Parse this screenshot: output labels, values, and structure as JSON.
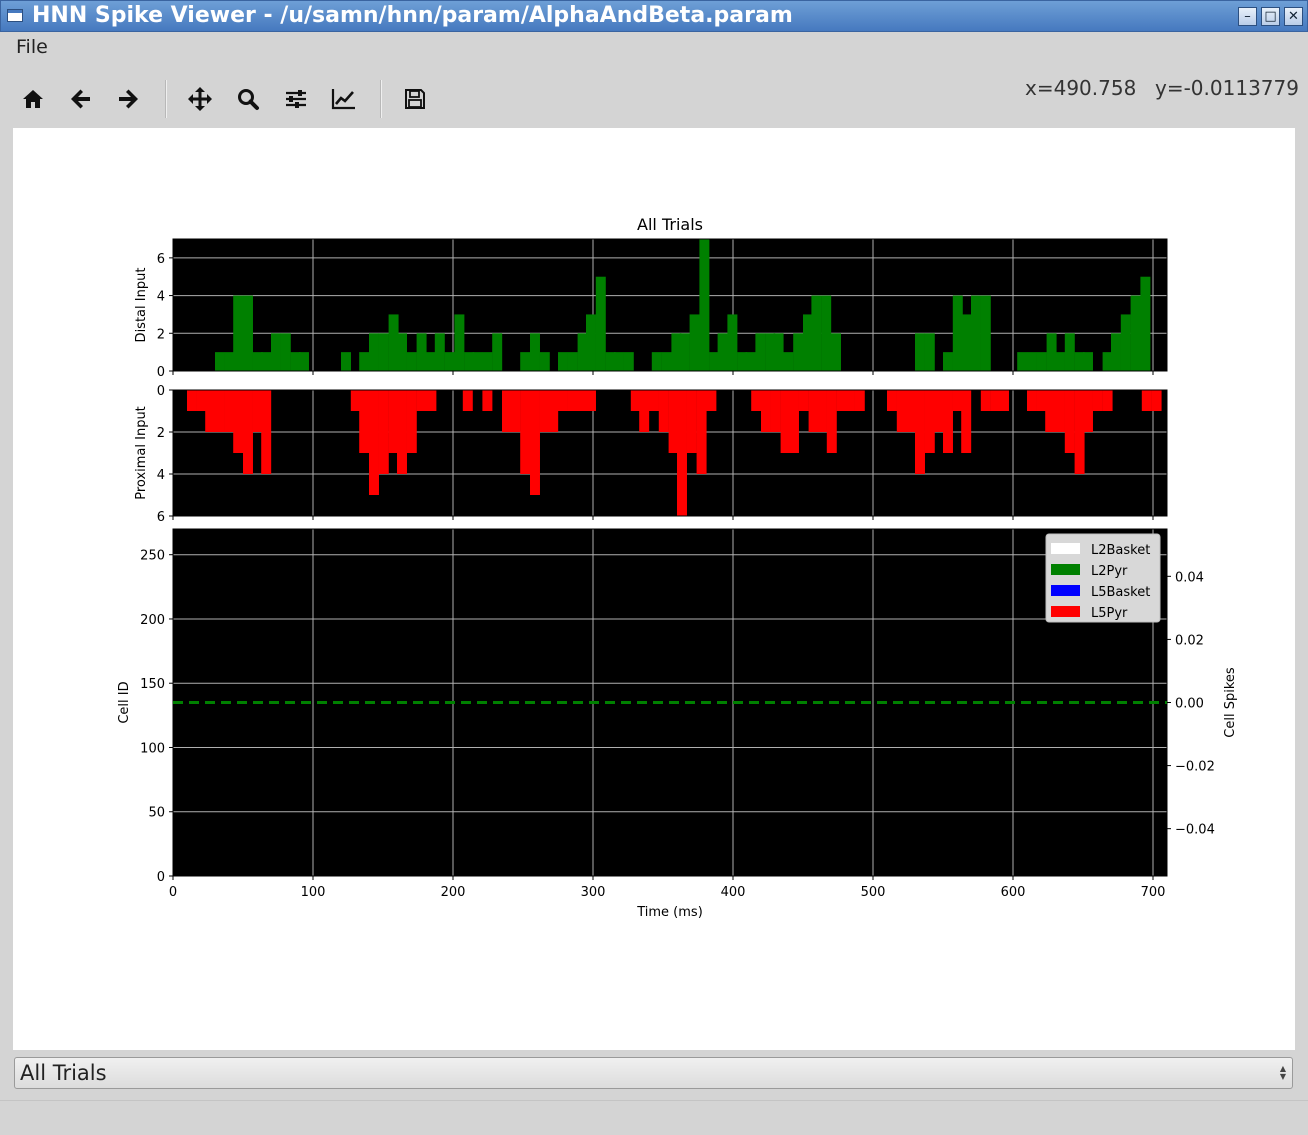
{
  "window": {
    "title": "HNN Spike Viewer - /u/samn/hnn/param/AlphaAndBeta.param"
  },
  "menu": {
    "file_label": "File"
  },
  "toolbar": {
    "buttons": [
      "home-icon",
      "back-arrow-icon",
      "forward-arrow-icon",
      "pan-icon",
      "zoom-icon",
      "subplots-icon",
      "axes-edit-icon",
      "save-icon"
    ],
    "coords": {
      "x": "x=490.758",
      "y": "y=-0.0113779"
    }
  },
  "colors": {
    "distal": "#008000",
    "proximal": "#ff0000",
    "plot_bg": "#000000",
    "grid": "#b0b0b0",
    "dashed_line": "#008000"
  },
  "chart_data": [
    {
      "type": "bar",
      "title": "All Trials",
      "ylabel": "Distal Input",
      "inverted_y": true,
      "xlim": [
        0,
        710
      ],
      "ylim": [
        7,
        0
      ],
      "yticks": [
        0,
        2,
        4,
        6
      ],
      "grid": true,
      "bin_width": 6.7,
      "series": [
        {
          "color": "#008000",
          "x": [
            30,
            37,
            43,
            50,
            57,
            63,
            70,
            77,
            84,
            90,
            120,
            127,
            133,
            140,
            147,
            154,
            160,
            167,
            174,
            181,
            187,
            194,
            201,
            208,
            214,
            221,
            228,
            248,
            255,
            262,
            275,
            282,
            289,
            295,
            302,
            309,
            315,
            322,
            342,
            349,
            356,
            362,
            369,
            376,
            383,
            389,
            396,
            403,
            409,
            416,
            423,
            429,
            436,
            443,
            450,
            456,
            463,
            470,
            530,
            537,
            543,
            550,
            557,
            563,
            570,
            577,
            584,
            603,
            610,
            617,
            624,
            630,
            637,
            644,
            650,
            664,
            670,
            677,
            684,
            691
          ],
          "y": [
            1,
            1,
            4,
            4,
            1,
            1,
            2,
            2,
            1,
            1,
            1,
            0,
            1,
            2,
            2,
            3,
            2,
            1,
            2,
            1,
            2,
            1,
            3,
            1,
            1,
            1,
            2,
            1,
            2,
            1,
            1,
            1,
            2,
            3,
            5,
            1,
            1,
            1,
            1,
            1,
            2,
            2,
            3,
            7,
            1,
            2,
            3,
            1,
            1,
            2,
            2,
            2,
            1,
            2,
            3,
            4,
            4,
            2,
            2,
            2,
            0,
            1,
            4,
            3,
            4,
            4,
            0,
            1,
            1,
            1,
            2,
            1,
            2,
            1,
            1,
            1,
            2,
            3,
            4,
            5
          ]
        }
      ]
    },
    {
      "type": "bar",
      "ylabel": "Proximal Input",
      "xlim": [
        0,
        710
      ],
      "ylim": [
        0,
        6
      ],
      "yticks": [
        0,
        2,
        4,
        6
      ],
      "grid": true,
      "bin_width": 6.7,
      "series": [
        {
          "color": "#ff0000",
          "x": [
            10,
            17,
            23,
            30,
            37,
            43,
            50,
            57,
            63,
            70,
            127,
            133,
            140,
            147,
            154,
            160,
            167,
            174,
            181,
            207,
            221,
            235,
            241,
            248,
            255,
            262,
            268,
            275,
            282,
            288,
            295,
            327,
            333,
            340,
            347,
            354,
            360,
            367,
            374,
            381,
            387,
            413,
            420,
            427,
            434,
            440,
            447,
            454,
            460,
            467,
            474,
            480,
            487,
            510,
            517,
            523,
            530,
            537,
            543,
            550,
            557,
            563,
            570,
            577,
            584,
            590,
            597,
            610,
            617,
            623,
            630,
            637,
            644,
            650,
            657,
            664,
            671,
            681,
            692,
            699
          ],
          "y": [
            1,
            1,
            2,
            2,
            2,
            3,
            4,
            2,
            4,
            0,
            1,
            3,
            5,
            4,
            3,
            4,
            3,
            1,
            1,
            1,
            1,
            2,
            2,
            4,
            5,
            2,
            2,
            1,
            1,
            1,
            1,
            1,
            2,
            1,
            2,
            3,
            6,
            3,
            4,
            1,
            0,
            1,
            2,
            2,
            3,
            3,
            1,
            2,
            2,
            3,
            1,
            1,
            1,
            1,
            2,
            2,
            4,
            3,
            2,
            3,
            1,
            3,
            0,
            1,
            1,
            1,
            0,
            1,
            1,
            2,
            2,
            3,
            4,
            2,
            1,
            1,
            0,
            0,
            1,
            1
          ]
        }
      ]
    },
    {
      "type": "scatter",
      "xlabel": "Time (ms)",
      "ylabel": "Cell ID",
      "y2label": "Cell Spikes",
      "xlim": [
        0,
        710
      ],
      "ylim": [
        270,
        0
      ],
      "xticks": [
        0,
        100,
        200,
        300,
        400,
        500,
        600,
        700
      ],
      "yticks": [
        0,
        50,
        100,
        150,
        200,
        250
      ],
      "y2lim": [
        -0.055,
        0.055
      ],
      "y2ticks": [
        0.04,
        0.02,
        0.0,
        -0.02,
        -0.04
      ],
      "y2ticklabels": [
        "0.04",
        "0.02",
        "0.00",
        "−0.02",
        "−0.04"
      ],
      "grid": true,
      "legend": {
        "placement": "top-right",
        "entries": [
          {
            "label": "L2Basket",
            "color": "#ffffff"
          },
          {
            "label": "L2Pyr",
            "color": "#008000"
          },
          {
            "label": "L5Basket",
            "color": "#0000ff"
          },
          {
            "label": "L5Pyr",
            "color": "#ff0000"
          }
        ]
      },
      "series": [
        {
          "type": "hline",
          "y2": 0.0,
          "style": "dashed",
          "color": "#008000"
        }
      ]
    }
  ],
  "trial_select": {
    "value": "All Trials"
  }
}
